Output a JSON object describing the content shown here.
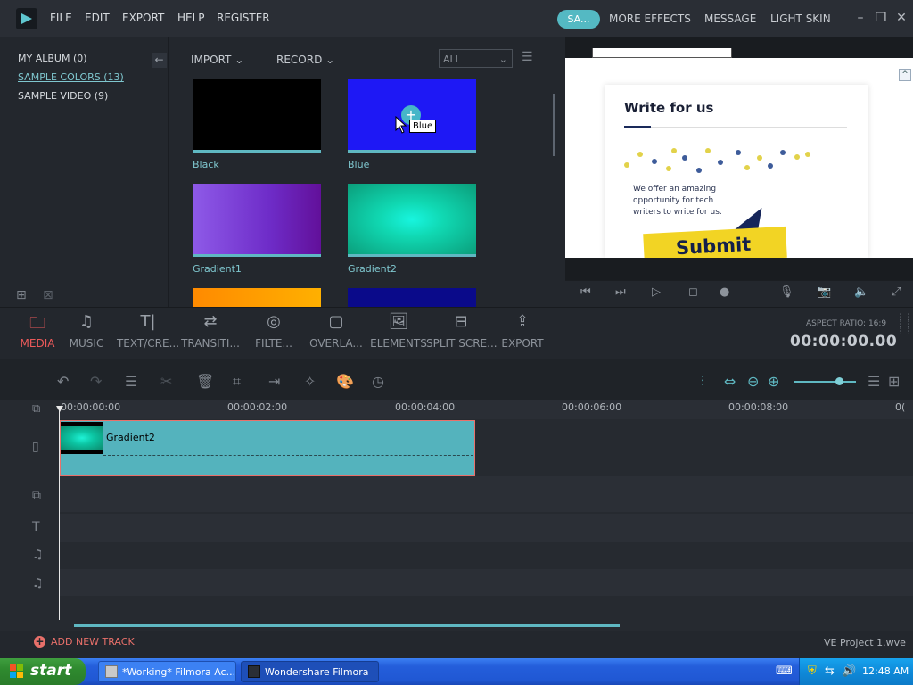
{
  "menubar": {
    "items": [
      "FILE",
      "EDIT",
      "EXPORT",
      "HELP",
      "REGISTER"
    ],
    "save_button": "SA...",
    "right_items": [
      "MORE EFFECTS",
      "MESSAGE",
      "LIGHT SKIN"
    ]
  },
  "library": {
    "items": [
      {
        "label": "MY ALBUM (0)",
        "active": false
      },
      {
        "label": "SAMPLE COLORS (13)",
        "active": true
      },
      {
        "label": "SAMPLE VIDEO (9)",
        "active": false
      }
    ]
  },
  "media": {
    "import_label": "IMPORT",
    "record_label": "RECORD",
    "filter_value": "ALL",
    "tooltip": "Blue",
    "thumbnails": [
      {
        "label": "Black",
        "color": "#000000"
      },
      {
        "label": "Blue",
        "color": "#1e18f5"
      },
      {
        "label": "Gradient1",
        "color": "#7d2ed0"
      },
      {
        "label": "Gradient2",
        "color": "#10d8b2"
      }
    ]
  },
  "preview": {
    "heading": "Write for us",
    "body": "We offer an amazing opportunity for tech writers to write for us.",
    "cta": "Submit"
  },
  "tabs": [
    {
      "label": "MEDIA",
      "icon": "folder-icon",
      "active": true
    },
    {
      "label": "MUSIC",
      "icon": "music-icon",
      "active": false
    },
    {
      "label": "TEXT/CRE...",
      "icon": "text-icon",
      "active": false
    },
    {
      "label": "TRANSITI...",
      "icon": "transition-icon",
      "active": false
    },
    {
      "label": "FILTE...",
      "icon": "filter-icon",
      "active": false
    },
    {
      "label": "OVERLA...",
      "icon": "overlay-icon",
      "active": false
    },
    {
      "label": "ELEMENTS",
      "icon": "image-icon",
      "active": false
    },
    {
      "label": "SPLIT SCRE...",
      "icon": "split-screen-icon",
      "active": false
    },
    {
      "label": "EXPORT",
      "icon": "export-icon",
      "active": false
    }
  ],
  "aspect_ratio": "ASPECT RATIO: 16:9",
  "timecode": "00:00:00.00",
  "timeline": {
    "ruler": [
      "00:00:00:00",
      "00:00:02:00",
      "00:00:04:00",
      "00:00:06:00",
      "00:00:08:00",
      "0("
    ],
    "clip_label": "Gradient2",
    "add_track": "ADD NEW TRACK",
    "project_name": "VE Project 1.wve"
  },
  "taskbar": {
    "start": "start",
    "buttons": [
      "*Working* Filmora Ac...",
      "Wondershare Filmora"
    ],
    "clock": "12:48 AM"
  }
}
